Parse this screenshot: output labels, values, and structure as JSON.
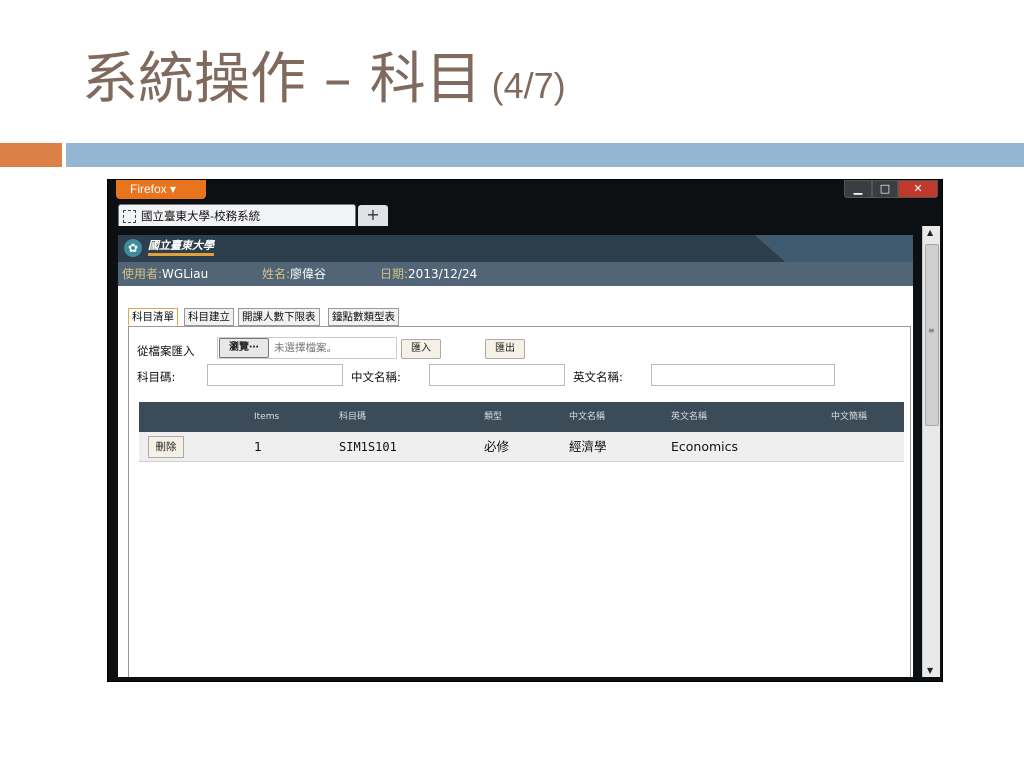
{
  "slide": {
    "title": "系統操作 – 科目",
    "subtitle": "(4/7)"
  },
  "browser": {
    "app_button": "Firefox ▾",
    "tab_title": "國立臺東大學-校務系統",
    "new_tab": "+",
    "controls": {
      "minimize": "▁",
      "maximize": "□",
      "close": "✕"
    }
  },
  "header": {
    "logo_text": "國立臺東大學"
  },
  "userbar": {
    "user_key": "使用者:",
    "user_value": "WGLiau",
    "name_key": "姓名:",
    "name_value": "廖偉谷",
    "date_key": "日期:",
    "date_value": "2013/12/24"
  },
  "subtabs": [
    "科目清單",
    "科目建立",
    "開課人數下限表",
    "鐘點數類型表"
  ],
  "form": {
    "file_label": "從檔案匯入",
    "browse_button": "瀏覽⋯",
    "file_placeholder": "未選擇檔案。",
    "import_button": "匯入",
    "export_button": "匯出",
    "code_label": "科目碼:",
    "zh_name_label": "中文名稱:",
    "en_name_label": "英文名稱:"
  },
  "table": {
    "columns": [
      "Items",
      "科目碼",
      "類型",
      "中文名稱",
      "英文名稱",
      "中文簡稱"
    ],
    "rows": [
      {
        "action": "刪除",
        "items": "1",
        "code": "SIM1S101",
        "type": "必修",
        "zh_name": "經濟學",
        "en_name": "Economics",
        "zh_short": ""
      }
    ]
  },
  "colors": {
    "title": "#7f6a5d",
    "band_orange": "#dd8047",
    "band_blue": "#94b6d2",
    "header_bg": "#2d3e4c",
    "userbar_bg": "#516576",
    "table_head_bg": "#3b4b58"
  }
}
